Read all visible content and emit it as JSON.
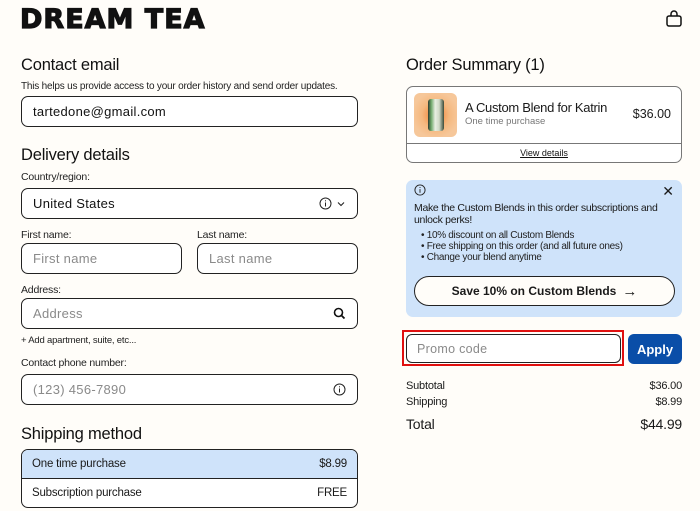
{
  "header": {
    "brand": "DREAM TEA",
    "cart_icon": "shopping-bag-icon"
  },
  "contact": {
    "title": "Contact email",
    "helper": "This helps us provide access to your order history and send order updates.",
    "email_value": "tartedone@gmail.com"
  },
  "delivery": {
    "title": "Delivery details",
    "country_label": "Country/region:",
    "country_value": "United States",
    "first_name_label": "First name:",
    "first_name_placeholder": "First name",
    "last_name_label": "Last name:",
    "last_name_placeholder": "Last name",
    "address_label": "Address:",
    "address_placeholder": "Address",
    "add_apartment": "+ Add apartment, suite, etc...",
    "phone_label": "Contact phone number:",
    "phone_placeholder": "(123) 456-7890"
  },
  "shipping": {
    "title": "Shipping method",
    "options": [
      {
        "label": "One time purchase",
        "price": "$8.99",
        "selected": true
      },
      {
        "label": "Subscription purchase",
        "price": "FREE",
        "selected": false
      }
    ]
  },
  "order_summary": {
    "title": "Order Summary (1)",
    "item": {
      "name": "A Custom Blend for Katrin",
      "subtitle": "One time purchase",
      "price": "$36.00"
    },
    "view_details": "View details"
  },
  "subscription_banner": {
    "title": "Make the Custom Blends in this order subscriptions and unlock perks!",
    "perks": [
      "10% discount on all Custom Blends",
      "Free shipping on this order (and all future ones)",
      "Change your blend anytime"
    ],
    "button": "Save 10% on Custom Blends",
    "button_arrow": "→",
    "close": "✕"
  },
  "promo": {
    "placeholder": "Promo code",
    "apply": "Apply"
  },
  "totals": {
    "subtotal_label": "Subtotal",
    "subtotal": "$36.00",
    "shipping_label": "Shipping",
    "shipping": "$8.99",
    "total_label": "Total",
    "total": "$44.99"
  },
  "colors": {
    "accent_blue": "#0a4ea8",
    "light_blue": "#cfe3fa",
    "highlight_red": "#e01010",
    "background": "#fffdf9"
  }
}
